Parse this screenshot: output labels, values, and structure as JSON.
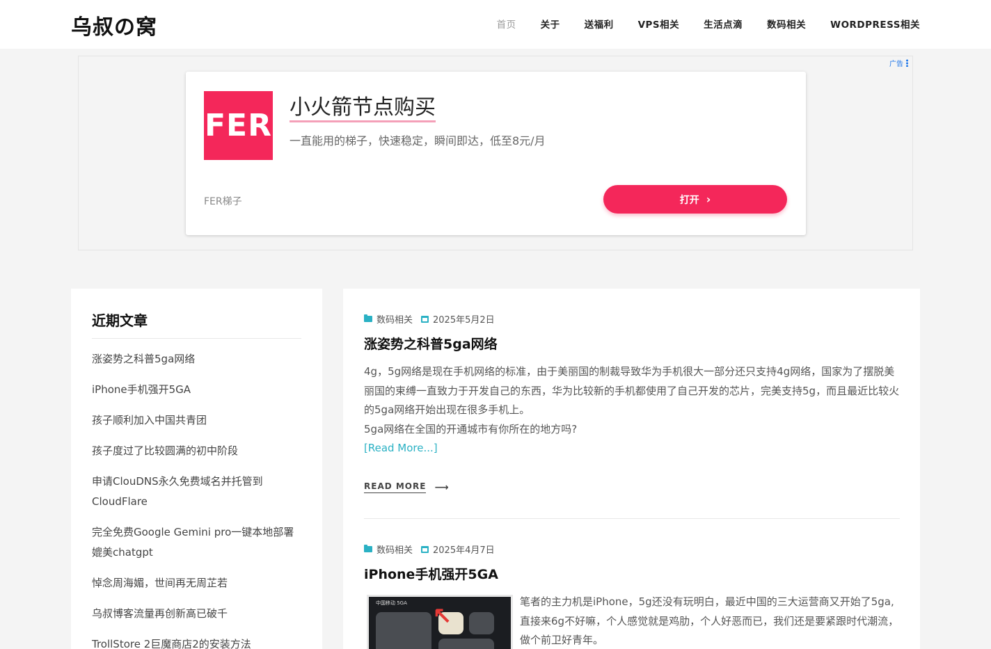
{
  "site": {
    "logo": "乌叔の窝"
  },
  "nav": {
    "items": [
      "首页",
      "关于",
      "送福利",
      "VPS相关",
      "生活点滴",
      "数码相关",
      "WORDPRESS相关"
    ]
  },
  "ad": {
    "label": "广告",
    "logo_text": "FER",
    "title": "小火箭节点购买",
    "description": "一直能用的梯子，快速稳定，瞬间即达，低至8元/月",
    "brand": "FER梯子",
    "button": "打开",
    "colors": {
      "accent": "#f4275a"
    }
  },
  "sidebar": {
    "title": "近期文章",
    "items": [
      "涨姿势之科普5ga网络",
      "iPhone手机强开5GA",
      "孩子顺利加入中国共青团",
      "孩子度过了比较圆满的初中阶段",
      "申请ClouDNS永久免费域名并托管到CloudFlare",
      "完全免费Google Gemini pro一键本地部署媲美chatgpt",
      "悼念周海媚，世间再无周芷若",
      "乌叔博客流量再创新高已破千",
      "TrollStore 2巨魔商店2的安装方法"
    ]
  },
  "posts": [
    {
      "category": "数码相关",
      "date": "2025年5月2日",
      "title": "涨姿势之科普5ga网络",
      "excerpt": "4g，5g网络是现在手机网络的标准，由于美丽国的制裁导致华为手机很大一部分还只支持4g网络，国家为了摆脱美丽国的束缚一直致力于开发自己的东西，华为比较新的手机都使用了自己开发的芯片，完美支持5g，而且最近比较火的5ga网络开始出现在很多手机上。",
      "excerpt_line2": "5ga网络在全国的开通城市有你所在的地方吗?",
      "read_more_inline": "[Read More...]",
      "read_more": "READ MORE"
    },
    {
      "category": "数码相关",
      "date": "2025年4月7日",
      "title": "iPhone手机强开5GA",
      "thumb_status": "中国移动 5GA",
      "excerpt": "笔者的主力机是iPhone，5g还没有玩明白，最近中国的三大运营商又开始了5ga,直接来6g不好嘛，个人感觉就是鸡肋，个人好恶而已，我们还是要紧跟时代潮流，做个前卫好青年。"
    }
  ],
  "icons": {
    "category": "folder-icon",
    "date": "calendar-icon",
    "read_more": "arrow-right-icon",
    "ad_menu": "more-vert-icon",
    "ad_button": "chevron-right-icon"
  }
}
